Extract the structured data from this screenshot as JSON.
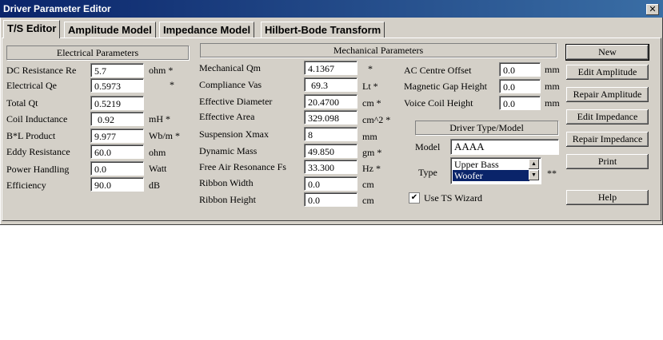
{
  "window": {
    "title": "Driver Parameter Editor",
    "close_glyph": "✕"
  },
  "tabs": [
    "T/S Editor",
    "Amplitude Model",
    "Impedance Model",
    "Hilbert-Bode Transform"
  ],
  "electrical": {
    "header": "Electrical Parameters",
    "rows": [
      {
        "label": "DC Resistance Re",
        "value": "5.7",
        "unit": "ohm *"
      },
      {
        "label": "Electrical Qe",
        "value": "0.5973",
        "unit": "*"
      },
      {
        "label": "Total Qt",
        "value": "0.5219",
        "unit": ""
      },
      {
        "label": "Coil Inductance",
        "value": "0.92",
        "unit": "mH  *"
      },
      {
        "label": "B*L Product",
        "value": "9.977",
        "unit": "Wb/m *"
      },
      {
        "label": "Eddy Resistance",
        "value": "60.0",
        "unit": "ohm"
      },
      {
        "label": "Power Handling",
        "value": "0.0",
        "unit": "Watt"
      },
      {
        "label": "Efficiency",
        "value": "90.0",
        "unit": "dB"
      }
    ]
  },
  "mechanical": {
    "header": "Mechanical Parameters",
    "rows": [
      {
        "label": "Mechanical Qm",
        "value": "4.1367",
        "unit": "*"
      },
      {
        "label": "Compliance Vas",
        "value": "69.3",
        "unit": "Lt  *"
      },
      {
        "label": "Effective Diameter",
        "value": "20.4700",
        "unit": "cm  *"
      },
      {
        "label": "Effective Area",
        "value": "329.098",
        "unit": "cm^2  *"
      },
      {
        "label": "Suspension Xmax",
        "value": "8",
        "unit": "mm"
      },
      {
        "label": "Dynamic Mass",
        "value": "49.850",
        "unit": "gm *"
      },
      {
        "label": "Free Air Resonance Fs",
        "value": "33.300",
        "unit": "Hz  *"
      },
      {
        "label": "Ribbon Width",
        "value": "0.0",
        "unit": "cm"
      },
      {
        "label": "Ribbon Height",
        "value": "0.0",
        "unit": "cm"
      }
    ],
    "extra": [
      {
        "label": "AC Centre Offset",
        "value": "0.0",
        "unit": "mm"
      },
      {
        "label": "Magnetic Gap Height",
        "value": "0.0",
        "unit": "mm"
      },
      {
        "label": "Voice Coil Height",
        "value": "0.0",
        "unit": "mm"
      }
    ]
  },
  "driver_type": {
    "header": "Driver Type/Model",
    "model_label": "Model",
    "model_value": "AAAA",
    "type_label": "Type",
    "options": [
      "Upper Bass",
      "Woofer"
    ],
    "selected": "Woofer",
    "marker": "**"
  },
  "ts_wizard": {
    "label": "Use TS Wizard",
    "checked": true,
    "check_glyph": "✔"
  },
  "buttons": [
    "New",
    "Edit Amplitude",
    "Repair Amplitude",
    "Edit Impedance",
    "Repair Impedance",
    "Print",
    "Help"
  ]
}
